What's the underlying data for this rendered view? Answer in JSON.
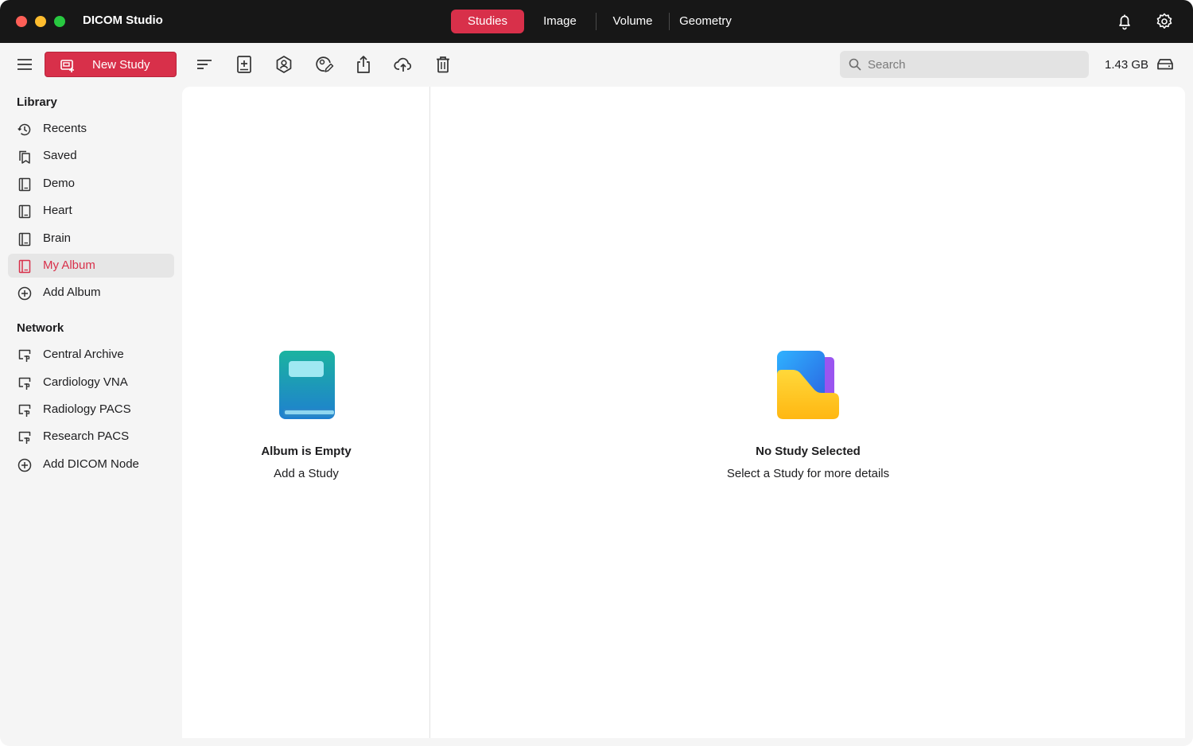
{
  "window": {
    "title": "DICOM Studio"
  },
  "tabs": [
    {
      "label": "Studies",
      "active": true
    },
    {
      "label": "Image",
      "active": false
    },
    {
      "label": "Volume",
      "active": false
    },
    {
      "label": "Geometry",
      "active": false
    }
  ],
  "titlebar_icons": [
    "bell-icon",
    "gear-icon"
  ],
  "toolbar": {
    "new_study_label": "New Study",
    "icons": [
      "menu-icon",
      "sort-icon",
      "add-document-icon",
      "anonymize-icon",
      "edit-icon",
      "share-icon",
      "cloud-upload-icon",
      "trash-icon"
    ],
    "search_placeholder": "Search",
    "storage_used": "1.43 GB"
  },
  "sidebar": {
    "library_title": "Library",
    "library_items": [
      {
        "label": "Recents",
        "icon": "clock-icon"
      },
      {
        "label": "Saved",
        "icon": "bookmark-icon"
      },
      {
        "label": "Demo",
        "icon": "album-icon"
      },
      {
        "label": "Heart",
        "icon": "album-icon"
      },
      {
        "label": "Brain",
        "icon": "album-icon"
      },
      {
        "label": "My Album",
        "icon": "album-icon",
        "selected": true
      },
      {
        "label": "Add Album",
        "icon": "plus-circle-icon"
      }
    ],
    "network_title": "Network",
    "network_items": [
      {
        "label": "Central Archive",
        "icon": "server-icon"
      },
      {
        "label": "Cardiology VNA",
        "icon": "server-icon"
      },
      {
        "label": "Radiology PACS",
        "icon": "server-icon"
      },
      {
        "label": "Research PACS",
        "icon": "server-icon"
      },
      {
        "label": "Add DICOM Node",
        "icon": "plus-circle-icon"
      }
    ]
  },
  "album_panel": {
    "title": "Album is Empty",
    "subtitle": "Add a Study"
  },
  "detail_panel": {
    "title": "No Study Selected",
    "subtitle": "Select a Study for more details"
  },
  "colors": {
    "accent": "#d8304a",
    "titlebar": "#171717",
    "sidebar_bg": "#f5f5f5"
  }
}
